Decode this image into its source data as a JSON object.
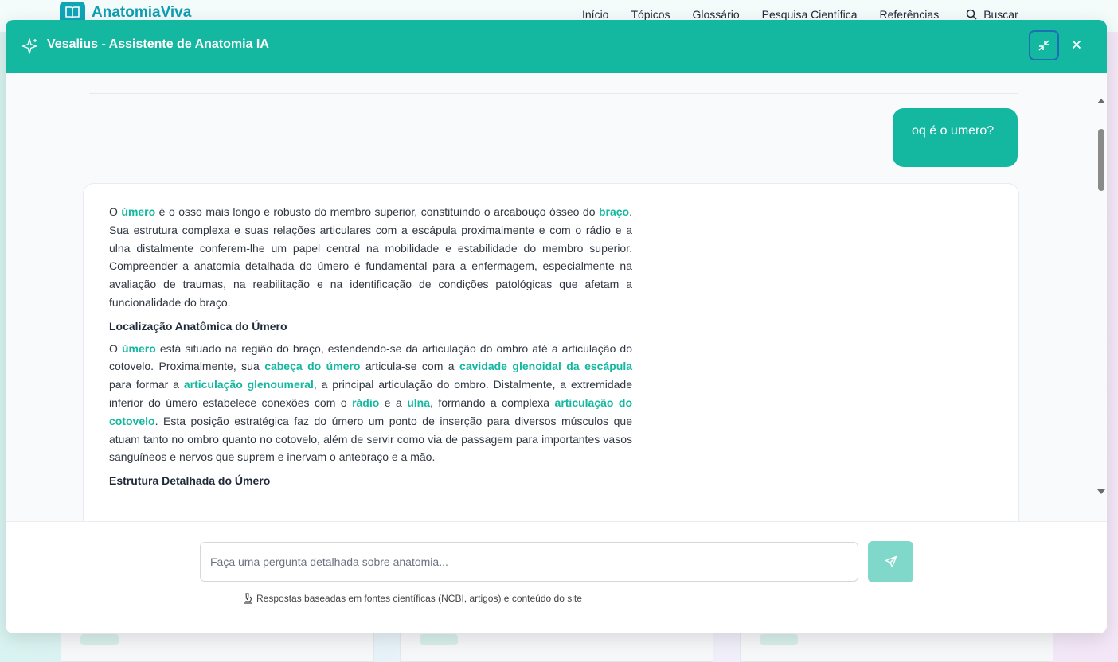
{
  "site": {
    "brand": "AnatomiaViva",
    "nav": [
      "Início",
      "Tópicos",
      "Glossário",
      "Pesquisa Científica",
      "Referências"
    ],
    "search_label": "Buscar"
  },
  "modal": {
    "title": "Vesalius - Assistente de Anatomia IA",
    "header_color": "#14b8a0"
  },
  "chat": {
    "user_message": "oq é o umero?",
    "assistant": {
      "p1": [
        "O ",
        "úmero",
        " é o osso mais longo e robusto do membro superior, constituindo o arcabouço ósseo do ",
        "braço",
        ". Sua estrutura complexa e suas relações articulares com a escápula proximalmente e com o rádio e a ulna distalmente conferem-lhe um papel central na mobilidade e estabilidade do membro superior. Compreender a anatomia detalhada do úmero é fundamental para a enfermagem, especialmente na avaliação de traumas, na reabilitação e na identificação de condições patológicas que afetam a funcionalidade do braço."
      ],
      "heading1": "Localização Anatômica do Úmero",
      "p2": [
        "O ",
        "úmero",
        " está situado na região do braço, estendendo-se da articulação do ombro até a articulação do cotovelo. Proximalmente, sua ",
        "cabeça do úmero",
        " articula-se com a ",
        "cavidade glenoidal da escápula",
        " para formar a ",
        "articulação glenoumeral",
        ", a principal articulação do ombro. Distalmente, a extremidade inferior do úmero estabelece conexões com o ",
        "rádio",
        " e a ",
        "ulna",
        ", formando a complexa ",
        "articulação do cotovelo",
        ". Esta posição estratégica faz do úmero um ponto de inserção para diversos músculos que atuam tanto no ombro quanto no cotovelo, além de servir como via de passagem para importantes vasos sanguíneos e nervos que suprem e inervam o antebraço e a mão."
      ],
      "heading2": "Estrutura Detalhada do Úmero"
    }
  },
  "input": {
    "placeholder": "Faça uma pergunta detalhada sobre anatomia...",
    "value": ""
  },
  "disclaimer": "Respostas baseadas em fontes científicas (NCBI, artigos) e conteúdo do site",
  "icons": {
    "header": "sparkle-icon",
    "minimize": "minimize-icon",
    "close": "close-icon",
    "send": "send-icon",
    "disclaimer": "microscope-icon",
    "search": "search-icon",
    "logo": "book-icon"
  }
}
